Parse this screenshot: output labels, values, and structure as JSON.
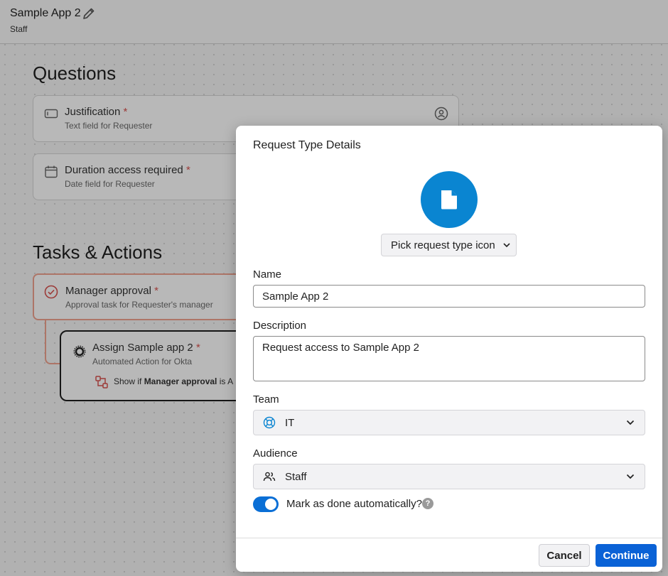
{
  "header": {
    "app_name": "Sample App 2",
    "subtitle": "Staff"
  },
  "questions": {
    "title": "Questions",
    "items": [
      {
        "title": "Justification",
        "required_mark": "*",
        "subtitle": "Text field for Requester",
        "icon": "text-field-icon"
      },
      {
        "title": "Duration access required",
        "required_mark": "*",
        "subtitle": "Date field for Requester",
        "icon": "calendar-icon"
      }
    ]
  },
  "tasks": {
    "title": "Tasks & Actions",
    "manager": {
      "title": "Manager approval",
      "required_mark": "*",
      "subtitle": "Approval task for Requester's manager"
    },
    "action": {
      "title": "Assign Sample app 2",
      "required_mark": "*",
      "subtitle": "Automated Action for Okta",
      "condition_prefix": "Show if ",
      "condition_bold": "Manager approval",
      "condition_suffix": " is A"
    }
  },
  "modal": {
    "title": "Request Type Details",
    "icon": "document-icon",
    "pick_icon_label": "Pick request type icon",
    "name_label": "Name",
    "name_value": "Sample App 2",
    "description_label": "Description",
    "description_value": "Request access to Sample App 2",
    "team_label": "Team",
    "team_value": "IT",
    "audience_label": "Audience",
    "audience_value": "Staff",
    "toggle_label": "Mark as done automatically?",
    "toggle_on": true,
    "help_glyph": "?",
    "cancel_label": "Cancel",
    "continue_label": "Continue"
  },
  "colors": {
    "accent": "#0a85d1",
    "primary_button": "#0a62d6",
    "required": "#d9534f",
    "task_border": "#f0a38f"
  }
}
